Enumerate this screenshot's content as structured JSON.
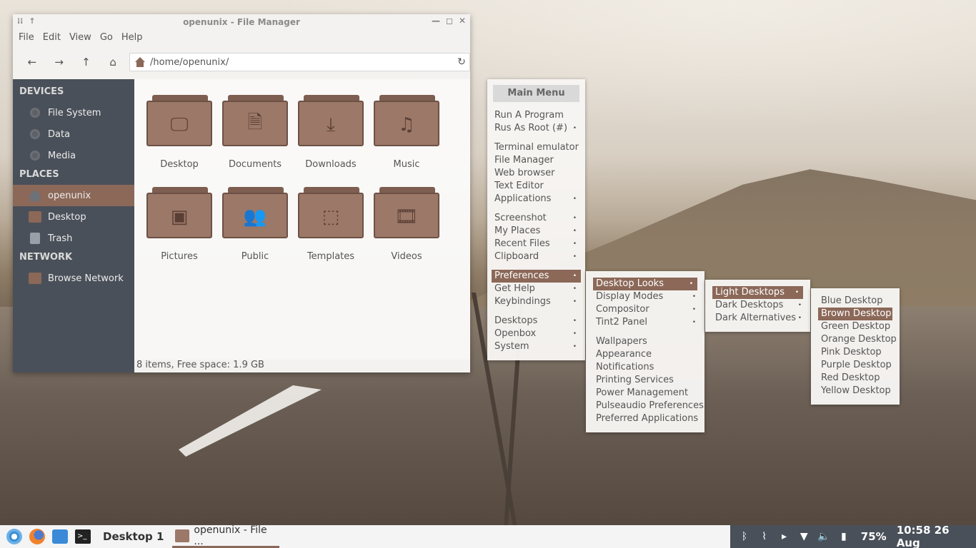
{
  "file_manager": {
    "title": "openunix - File Manager",
    "menu": [
      "File",
      "Edit",
      "View",
      "Go",
      "Help"
    ],
    "path": "/home/openunix/",
    "sidebar": {
      "devices_heading": "DEVICES",
      "devices": [
        "File System",
        "Data",
        "Media"
      ],
      "places_heading": "PLACES",
      "places": [
        "openunix",
        "Desktop",
        "Trash"
      ],
      "network_heading": "NETWORK",
      "network": [
        "Browse Network"
      ]
    },
    "folders": [
      {
        "label": "Desktop",
        "icon": "monitor-icon",
        "glyph": "🖵"
      },
      {
        "label": "Documents",
        "icon": "document-icon",
        "glyph": "🗎"
      },
      {
        "label": "Downloads",
        "icon": "download-icon",
        "glyph": "⤓"
      },
      {
        "label": "Music",
        "icon": "music-icon",
        "glyph": "♫"
      },
      {
        "label": "Pictures",
        "icon": "image-icon",
        "glyph": "▣"
      },
      {
        "label": "Public",
        "icon": "people-icon",
        "glyph": "👥"
      },
      {
        "label": "Templates",
        "icon": "template-icon",
        "glyph": "⬚"
      },
      {
        "label": "Videos",
        "icon": "film-icon",
        "glyph": "🎞"
      }
    ],
    "status": "8 items, Free space: 1.9 GB"
  },
  "main_menu": {
    "title": "Main Menu",
    "groups": [
      [
        {
          "label": "Run A Program",
          "sub": false
        },
        {
          "label": "Rus As Root (#)",
          "sub": true
        }
      ],
      [
        {
          "label": "Terminal emulator",
          "sub": false
        },
        {
          "label": "File Manager",
          "sub": false
        },
        {
          "label": "Web browser",
          "sub": false
        },
        {
          "label": "Text Editor",
          "sub": false
        },
        {
          "label": "Applications",
          "sub": true
        }
      ],
      [
        {
          "label": "Screenshot",
          "sub": true
        },
        {
          "label": "My Places",
          "sub": true
        },
        {
          "label": "Recent Files",
          "sub": true
        },
        {
          "label": "Clipboard",
          "sub": true
        }
      ],
      [
        {
          "label": "Preferences",
          "sub": true,
          "selected": true
        },
        {
          "label": "Get Help",
          "sub": true
        },
        {
          "label": "Keybindings",
          "sub": true
        }
      ],
      [
        {
          "label": "Desktops",
          "sub": true
        },
        {
          "label": "Openbox",
          "sub": true
        },
        {
          "label": "System",
          "sub": true
        }
      ]
    ]
  },
  "preferences_menu": {
    "groups": [
      [
        {
          "label": "Desktop Looks",
          "sub": true,
          "selected": true
        },
        {
          "label": "Display Modes",
          "sub": true
        },
        {
          "label": "Compositor",
          "sub": true
        },
        {
          "label": "Tint2 Panel",
          "sub": true
        }
      ],
      [
        {
          "label": "Wallpapers",
          "sub": false
        },
        {
          "label": "Appearance",
          "sub": false
        },
        {
          "label": "Notifications",
          "sub": false
        },
        {
          "label": "Printing Services",
          "sub": false
        },
        {
          "label": "Power Management",
          "sub": false
        },
        {
          "label": "Pulseaudio Preferences",
          "sub": false
        },
        {
          "label": "Preferred Applications",
          "sub": false
        }
      ]
    ]
  },
  "looks_menu": {
    "items": [
      {
        "label": "Light Desktops",
        "sub": true,
        "selected": true
      },
      {
        "label": "Dark Desktops",
        "sub": true
      },
      {
        "label": "Dark Alternatives",
        "sub": true
      }
    ]
  },
  "light_menu": {
    "items": [
      {
        "label": "Blue Desktop"
      },
      {
        "label": "Brown Desktop",
        "selected": true
      },
      {
        "label": "Green Desktop"
      },
      {
        "label": "Orange Desktop"
      },
      {
        "label": "Pink Desktop"
      },
      {
        "label": "Purple Desktop"
      },
      {
        "label": "Red Desktop"
      },
      {
        "label": "Yellow Desktop"
      }
    ]
  },
  "taskbar": {
    "workspace": "Desktop 1",
    "task": "openunix - File ...",
    "battery": "75%",
    "clock": "10:58 26 Aug"
  },
  "colors": {
    "accent": "#8b6858",
    "sidebar": "#4a5059",
    "folder": "#9b7868"
  }
}
